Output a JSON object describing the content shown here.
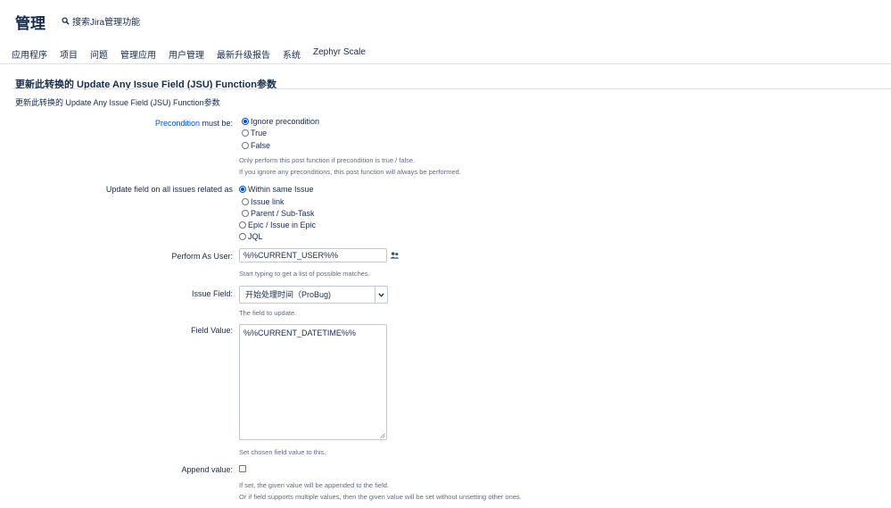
{
  "header": {
    "title": "管理",
    "search_text": "搜索Jira管理功能"
  },
  "nav": {
    "items": [
      "应用程序",
      "项目",
      "问题",
      "管理应用",
      "用户管理",
      "最新升级报告",
      "系统",
      "Zephyr Scale"
    ]
  },
  "section": {
    "title": "更新此转换的 Update Any Issue Field (JSU) Function参数",
    "description": "更新此转换的 Update Any Issue Field (JSU) Function参数"
  },
  "precondition": {
    "link": "Precondition",
    "label_rest": " must be:",
    "options": [
      "Ignore precondition",
      "True",
      "False"
    ],
    "selected": 0,
    "hint1": "Only perform this post function if precondition is true / false.",
    "hint2": "If you ignore any preconditions, this post function will always be performed."
  },
  "update_field": {
    "label": "Update field on all issues related as",
    "options": [
      "Within same Issue",
      "Issue link",
      "Parent / Sub-Task",
      "Epic / Issue in Epic",
      "JQL"
    ],
    "selected": 0
  },
  "perform_as": {
    "label": "Perform As User:",
    "value": "%%CURRENT_USER%%",
    "hint": "Start typing to get a list of possible matches."
  },
  "issue_field": {
    "label": "Issue Field:",
    "value": "开始处理时间（ProBug)",
    "hint": "The field to update."
  },
  "field_value": {
    "label": "Field Value:",
    "value": "%%CURRENT_DATETIME%%",
    "hint": "Set chosen field value to this."
  },
  "append_value": {
    "label": "Append value:",
    "checked": false,
    "hint1": "If set, the given value will be appended to the field.",
    "hint2": "Or if field supports multiple values, then the given value will be set without unsetting other ones."
  },
  "colors": {
    "link": "#0052cc",
    "text": "#172b4d",
    "hint": "#5e6c84",
    "border": "#c1c7d0"
  }
}
